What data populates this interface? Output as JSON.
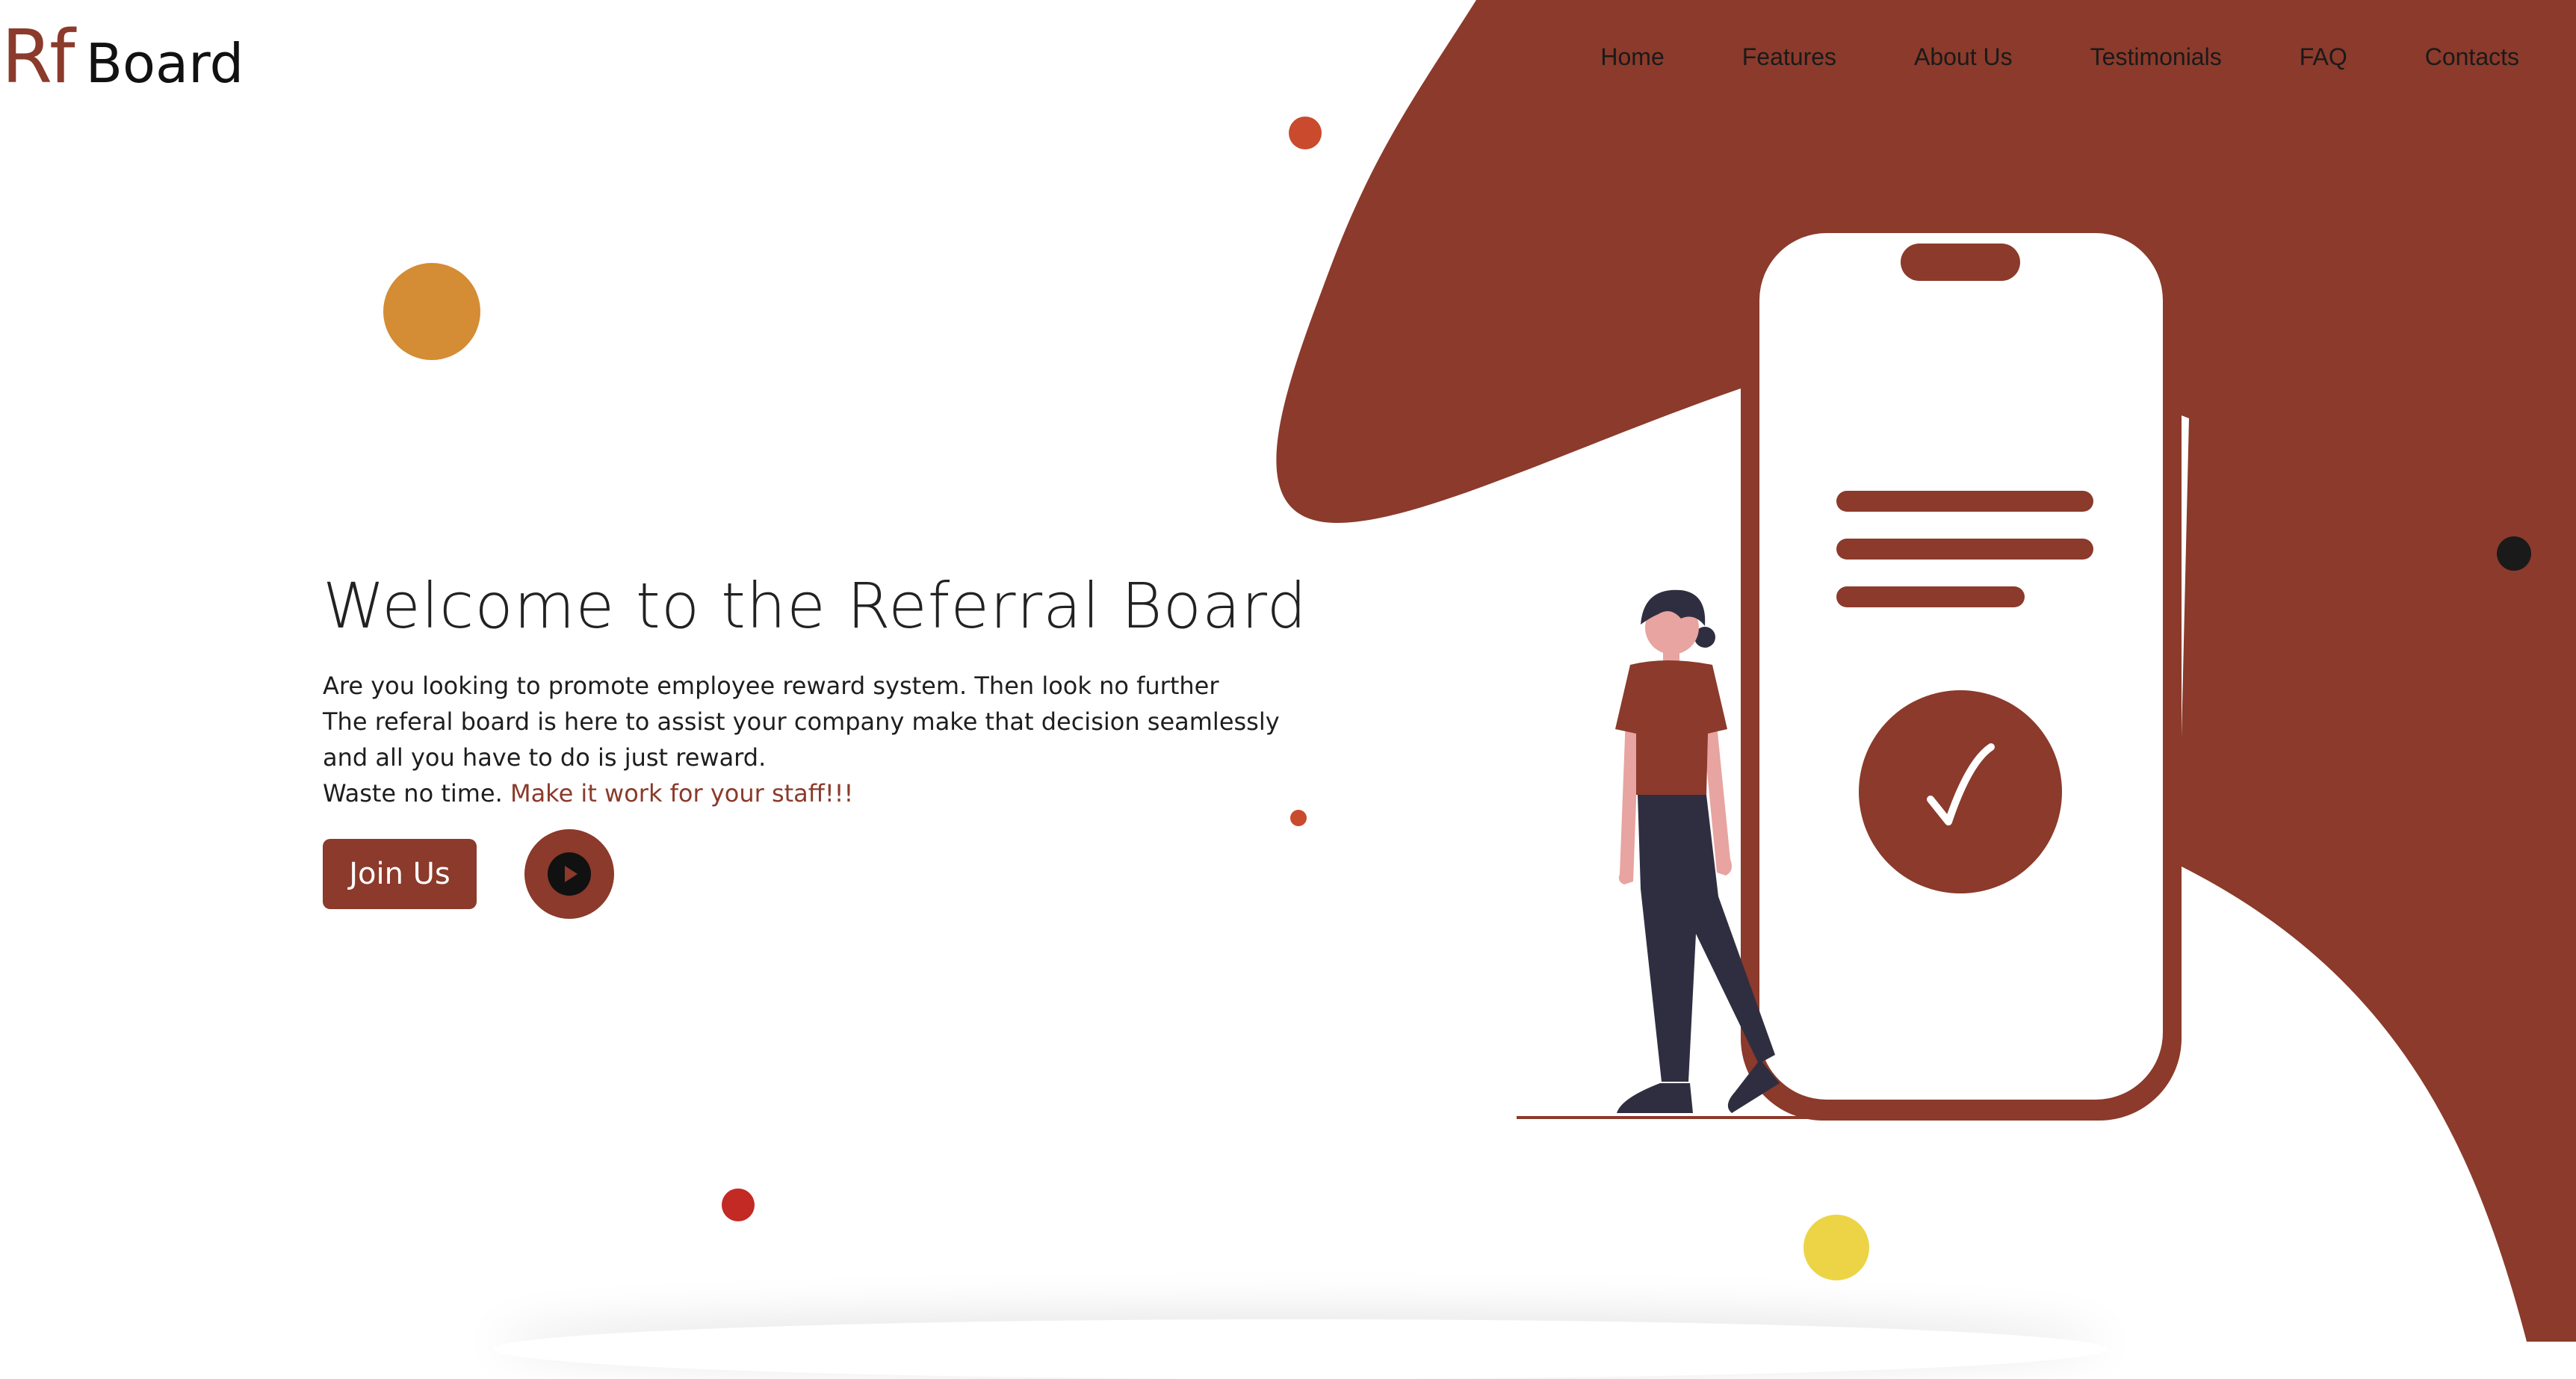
{
  "colors": {
    "brand": "#8b3a2b",
    "accent_orange": "#d48c35",
    "accent_yellow": "#ecd446",
    "accent_red": "#c32a24",
    "accent_vermilion": "#c94a2d",
    "ink": "#1a1a1a",
    "figure_pants": "#2f2e41",
    "figure_skin": "#e8a4a0"
  },
  "logo": {
    "rf": "Rf",
    "board": "Board"
  },
  "nav": {
    "items": [
      "Home",
      "Features",
      "About Us",
      "Testimonials",
      "FAQ",
      "Contacts"
    ]
  },
  "hero": {
    "title": "Welcome to the Referral Board",
    "lines": [
      "Are you looking to promote employee reward system. Then look no further",
      "The referal board is here to assist your company make that decision seamlessly",
      "and all you have to do is just reward."
    ],
    "last_line_prefix": "Waste no time. ",
    "last_line_accent": "Make it work for your staff!!!",
    "join_label": "Join Us"
  },
  "icons": {
    "play": "play-icon",
    "check": "check-icon"
  }
}
